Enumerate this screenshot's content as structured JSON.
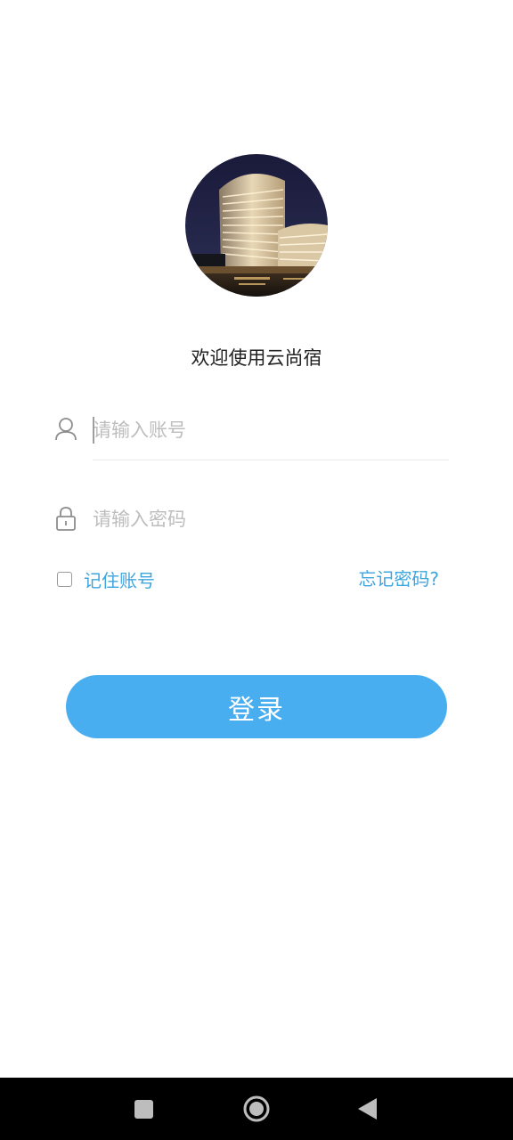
{
  "app": {
    "welcome_text": "欢迎使用云尚宿"
  },
  "login_form": {
    "account_placeholder": "请输入账号",
    "password_placeholder": "请输入密码",
    "remember_label": "记住账号",
    "remember_checked": false,
    "forgot_label": "忘记密码?",
    "login_label": "登录"
  },
  "colors": {
    "accent": "#3ea4dc",
    "button": "#49aeef",
    "text": "#222222",
    "placeholder": "#bdbdbd"
  },
  "icons": {
    "account": "user-icon",
    "password": "lock-icon",
    "nav_recents": "square-icon",
    "nav_home": "circle-icon",
    "nav_back": "triangle-back-icon"
  }
}
